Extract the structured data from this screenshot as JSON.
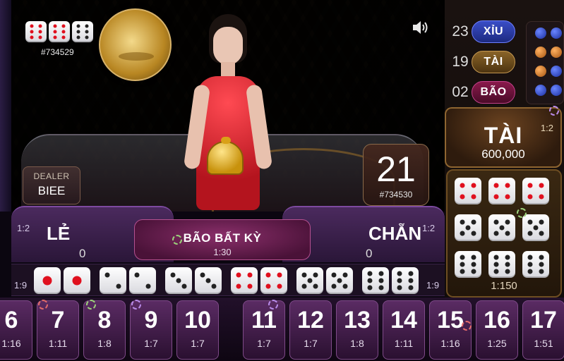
{
  "top_left": {
    "last_dice": [
      6,
      6,
      6
    ],
    "last_round_id": "#734529"
  },
  "dealer": {
    "label": "DEALER",
    "name": "BIEE"
  },
  "countdown": {
    "value": "21",
    "round_id": "#734530"
  },
  "stats": [
    {
      "count": "23",
      "label": "XỈU",
      "style": "xiu"
    },
    {
      "count": "19",
      "label": "TÀI",
      "style": "tai"
    },
    {
      "count": "02",
      "label": "BÃO",
      "style": "bao"
    }
  ],
  "road_colors": [
    "blue",
    "blue",
    "orange",
    "orange",
    "orange",
    "blue",
    "blue",
    "blue"
  ],
  "tai_box": {
    "title": "TÀI",
    "amount": "600,000",
    "odds": "1:2"
  },
  "triples": {
    "values": [
      1,
      2,
      3,
      4,
      5,
      6
    ],
    "odds": "1:150"
  },
  "bets": {
    "le": {
      "label": "LẺ",
      "amount": "0",
      "odds": "1:2",
      "pair_odds": "1:9"
    },
    "chan": {
      "label": "CHẴN",
      "amount": "0",
      "odds": "1:2",
      "pair_odds": "1:9"
    },
    "bao_bat_ky": {
      "label": "BÃO BẤT KỲ",
      "odds": "1:30"
    }
  },
  "pairs": [
    1,
    2,
    3,
    4,
    5,
    6
  ],
  "totals": [
    {
      "n": "6",
      "odds": "1:16"
    },
    {
      "n": "7",
      "odds": "1:11"
    },
    {
      "n": "8",
      "odds": "1:8"
    },
    {
      "n": "9",
      "odds": "1:7"
    },
    {
      "n": "10",
      "odds": "1:7"
    },
    {
      "n": "11",
      "odds": "1:7"
    },
    {
      "n": "12",
      "odds": "1:7"
    },
    {
      "n": "13",
      "odds": "1:8"
    },
    {
      "n": "14",
      "odds": "1:11"
    },
    {
      "n": "15",
      "odds": "1:16"
    },
    {
      "n": "16",
      "odds": "1:25"
    },
    {
      "n": "17",
      "odds": "1:51"
    }
  ],
  "icons": {
    "sound": "speaker-icon",
    "chip": "casino-chip-icon"
  },
  "colors": {
    "xiu": "#2a3aa8",
    "tai": "#6b4a1c",
    "bao": "#6a1238",
    "accent_purple": "#5a2b63"
  }
}
